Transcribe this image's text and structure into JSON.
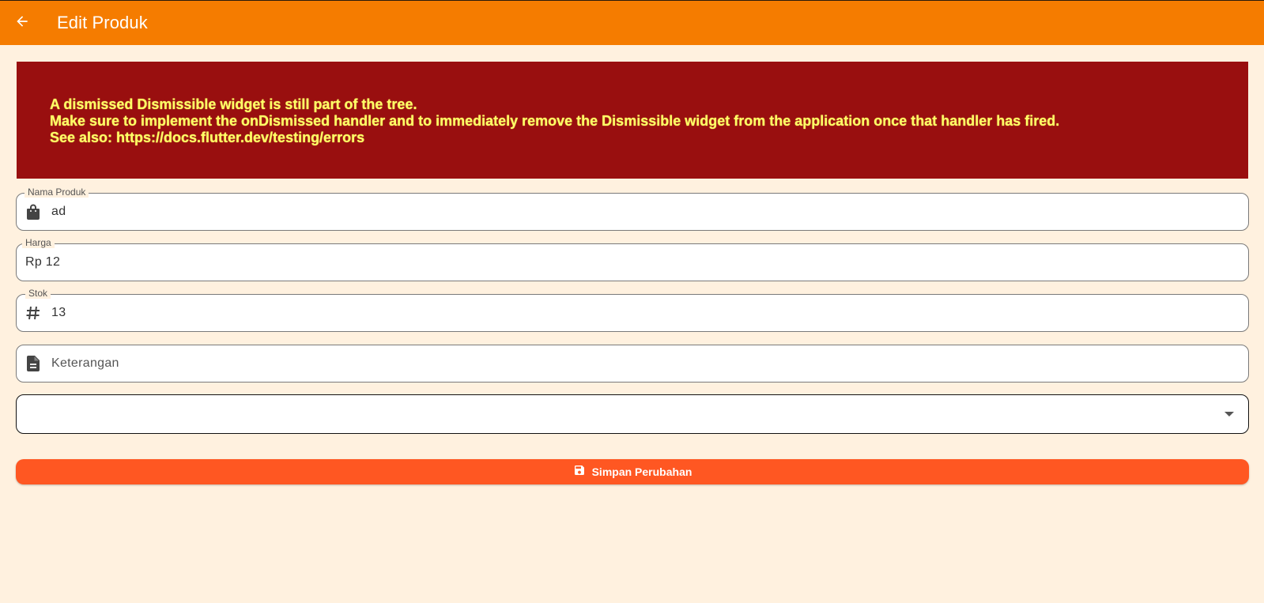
{
  "appbar": {
    "title": "Edit Produk",
    "back_icon": "arrow-back-icon",
    "color": "#f57c00"
  },
  "error": {
    "lines": [
      "A dismissed Dismissible widget is still part of the tree.",
      "Make sure to implement the onDismissed handler and to immediately remove the Dismissible widget from the application once that handler has fired.",
      "See also: https://docs.flutter.dev/testing/errors"
    ],
    "background": "#990f0f",
    "text_color": "#ffff66"
  },
  "form": {
    "nama": {
      "label": "Nama Produk",
      "value": "ad",
      "icon": "shopping-bag-icon"
    },
    "harga": {
      "label": "Harga",
      "value": "Rp 12"
    },
    "stok": {
      "label": "Stok",
      "value": "13",
      "icon": "hash-icon"
    },
    "keterangan": {
      "placeholder": "Keterangan",
      "icon": "description-icon"
    },
    "kategori": {
      "value": "",
      "icon": "dropdown-arrow-icon"
    }
  },
  "save_button": {
    "label": "Simpan Perubahan",
    "icon": "save-icon",
    "color": "#ff5722"
  }
}
